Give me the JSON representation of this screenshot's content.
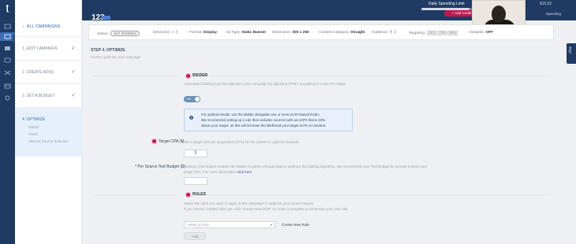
{
  "topbar": {
    "campaign_id": "123",
    "spending_limit_label": "Daily Spending Limit",
    "spending_fraction": 0.85,
    "add_credit_label": "Add Credit",
    "balance": "$10,62",
    "right_text": "Spending"
  },
  "sidebar": {
    "all_campaigns": "ALL CAMPAIGNS",
    "steps": [
      {
        "label": "1. EDIT CAMPAIGN",
        "done": true
      },
      {
        "label": "2. CREATE AD(S)",
        "done": true
      },
      {
        "label": "3. SET A BUDGET",
        "done": true
      },
      {
        "label": "4. OPTIMIZE",
        "done": false
      }
    ],
    "sub_items": [
      "Bidder",
      "Rules",
      "Manual Source Selection"
    ]
  },
  "info": {
    "status_label": "Status:",
    "status_value": "NOT RUNNING",
    "devices_label": "Device(s):",
    "format_label": "Format:",
    "format_value": "Display",
    "adtype_label": "Ad Type:",
    "adtype_value": "Static Banner",
    "dimension_label": "Dimension:",
    "dimension_value": "300 x 250",
    "content_label": "Content Category:",
    "content_value": "Straight",
    "audience_label": "Audience:",
    "targeting_label": "Targeting:",
    "targeting_tags": [
      "GEO",
      "CPM",
      "BRW"
    ],
    "autopilot_label": "Autopilot:",
    "autopilot_value": "OFF"
  },
  "main": {
    "title": "STEP 4. OPTIMIZE",
    "subtitle": "Further optimize your campaign",
    "bidder": {
      "title": "BIDDER",
      "desc": "Automated bidding tool that optimizes your campaign by adjusting CPM's according to a set CPA target",
      "toggle_label": "ON"
    },
    "infobox": {
      "line1": "For optimal results, use the Bidder alongside one or more eCPA based Rules.",
      "line2": "We recommend setting up a rule that excludes sources with an eCPA that is 15%",
      "line3": "above your target, as this will increase the likelihood your target eCPA is reached."
    },
    "target_cpa": {
      "label": "Target CPA ($)",
      "help": "Set a target cost per acquisition (CPA) for the system to optimize towards"
    },
    "test_budget": {
      "label": "Per Source Test Budget ($)",
      "help1": "Setting a test budget enables the Bidder to gather enough data to optimize the bidding algorithm. We recommend your Test Budget be at least 6 times your",
      "help2": "target CPA. For more information",
      "help_link": "click here"
    },
    "rules": {
      "title": "RULES",
      "desc1": "Select the rules you want to apply to this campaign to optimize your source targets.",
      "desc2": "If you haven't created rules yet, click \"Create New Rule\" to create a template or customize your own rule",
      "select_placeholder": "Select a Rule",
      "create_label": "Create New Rule",
      "add_label": "Add"
    }
  },
  "chat_tab": "Chat"
}
